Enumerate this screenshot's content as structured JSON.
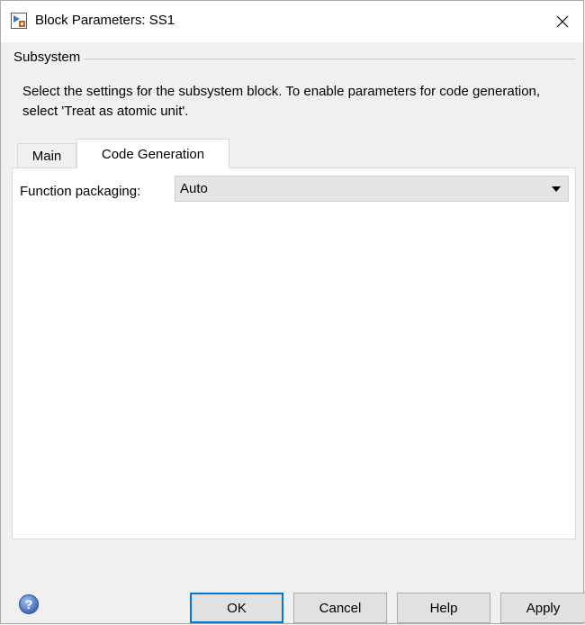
{
  "window": {
    "title": "Block Parameters: SS1",
    "close_symbol": "✕"
  },
  "group": {
    "legend": "Subsystem",
    "description": "Select the settings for the subsystem block. To enable parameters for code generation, select 'Treat as atomic unit'."
  },
  "tabs": [
    {
      "label": "Main",
      "active": false
    },
    {
      "label": "Code Generation",
      "active": true
    }
  ],
  "code_generation": {
    "function_packaging_label": "Function packaging:",
    "function_packaging_value": "Auto"
  },
  "buttons": {
    "ok": "OK",
    "cancel": "Cancel",
    "help": "Help",
    "apply": "Apply"
  },
  "icons": {
    "app": "simulink-block-icon",
    "help": "help-question-icon",
    "close": "close-icon"
  },
  "colors": {
    "focus_border": "#0078d7",
    "help_icon": "#3a62b8"
  }
}
